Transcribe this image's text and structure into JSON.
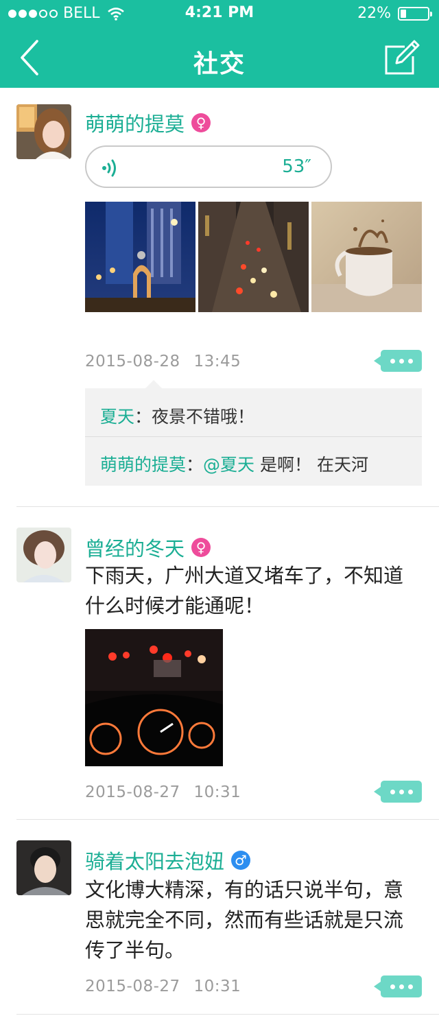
{
  "status_bar": {
    "carrier": "BELL",
    "time": "4:21 PM",
    "battery": "22%",
    "battery_level": 0.22
  },
  "nav": {
    "title": "社交",
    "back_icon": "chevron-left-icon",
    "compose_icon": "compose-icon"
  },
  "colors": {
    "accent": "#1bbfa0",
    "name": "#1bae94",
    "female": "#ee4c9b",
    "male": "#2d8ef0",
    "more_button": "#6dd8c6"
  },
  "posts": [
    {
      "username": "萌萌的提莫",
      "gender": "♀",
      "voice_duration": "53″",
      "date": "2015-08-28",
      "time": "13:45",
      "comments": [
        {
          "name": "夏天",
          "sep": "：",
          "text": "夜景不错哦！"
        },
        {
          "name": "萌萌的提莫",
          "sep": "：",
          "mention": "@夏天",
          "text": " 是啊！ 在天河"
        }
      ]
    },
    {
      "username": "曾经的冬天",
      "gender": "♀",
      "text": "下雨天，广州大道又堵车了，不知道什么时候才能通呢！",
      "date": "2015-08-27",
      "time": "10:31"
    },
    {
      "username": "骑着太阳去泡妞",
      "gender": "♂",
      "text": "文化博大精深，有的话只说半句，意思就完全不同，然而有些话就是只流传了半句。",
      "date": "2015-08-27",
      "time": "10:31"
    }
  ]
}
